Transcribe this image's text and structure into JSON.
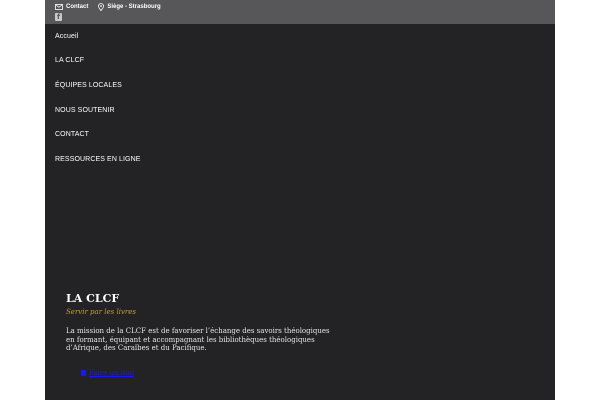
{
  "topbar": {
    "contact": {
      "label": "Contact",
      "icon": "mail-icon"
    },
    "location": {
      "label": "Siège - Strasbourg",
      "icon": "map-pin-icon"
    },
    "social": {
      "facebook_glyph": "f",
      "icon": "facebook-icon"
    }
  },
  "nav": {
    "items": [
      {
        "label": "Accueil"
      },
      {
        "label": "LA CLCF"
      },
      {
        "label": "ÉQUIPES LOCALES"
      },
      {
        "label": "NOUS SOUTENIR"
      },
      {
        "label": "CONTACT"
      },
      {
        "label": "RESSOURCES EN LIGNE"
      }
    ]
  },
  "about": {
    "title": "LA CLCF",
    "tagline": "Servir par les livres",
    "mission": "La mission de la CLCF est de favoriser l’échange des savoirs théologiques en formant, équipant et accompagnant les bibliothèques théologiques d’Afrique, des Caraïbes et du Pacifique."
  },
  "donate": {
    "label": "Faire un don"
  },
  "colors": {
    "page_bg": "#232325",
    "topbar_bg": "#575759",
    "accent": "#c79b3f",
    "link": "#1a1ae8"
  }
}
